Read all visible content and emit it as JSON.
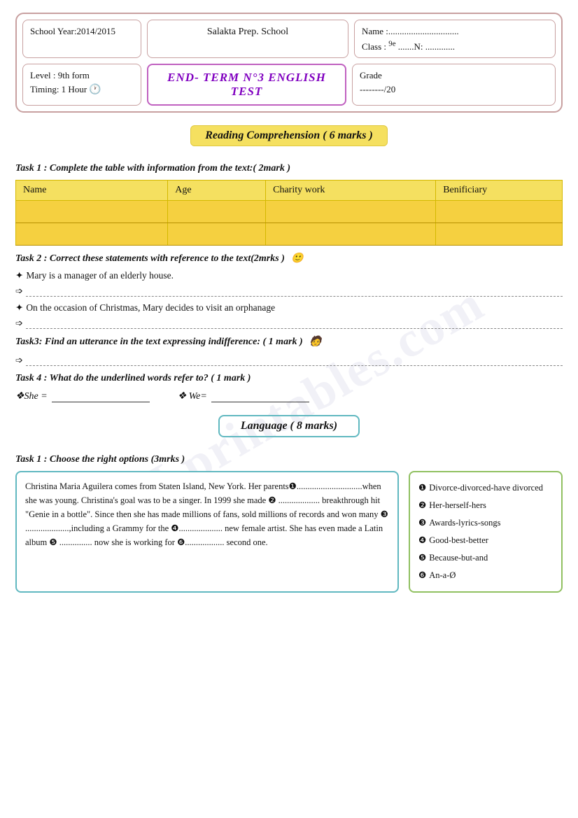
{
  "header": {
    "school_year_label": "School Year:2014/2015",
    "school_name": "Salakta Prep. School",
    "name_label": "Name :",
    "name_dots": "...............................",
    "class_label": "Class :",
    "class_value": "9ᵉ .......N: .............",
    "level_label": "Level : 9th form",
    "timing_label": "Timing: 1 Hour",
    "title": "END- TERM N°3 ENGLISH TEST",
    "grade_label": "Grade",
    "grade_value": "--------/20"
  },
  "reading": {
    "section_title": "Reading Comprehension ( 6 marks )",
    "task1_heading": "Task 1 : Complete the table with information from the text:( 2mark )",
    "table_headers": [
      "Name",
      "Age",
      "Charity work",
      "Benificiary"
    ],
    "task2_heading": "Task 2 :   Correct these statements  with reference to the text(2mrks )",
    "task2_s1": "✦Mary is a manager of an elderly house.",
    "task2_s2": "✦ On the occasion of Christmas, Mary decides to visit an orphanage",
    "task3_heading": "Task3:    Find an utterance in the text expressing indifference: ( 1 mark )",
    "task4_heading": "Task 4 : What do the underlined words refer to? ( 1 mark )",
    "task4_she": "❖She =",
    "task4_we": "❖ We="
  },
  "language": {
    "section_title": "Language  ( 8 marks)",
    "task1_heading": "Task 1 : Choose the right options (3mrks )",
    "passage": "Christina Maria Aguilera comes from Staten Island, New York. Her parents❶..............................when she was young. Christina's goal was to be a singer. In 1999 she made ❷ ................... breakthrough hit \"Genie in a bottle\". Since then she has made millions of fans, sold millions of records and won many ❸ ....................,including a Grammy for the ❹.................... new female artist. She has even made a Latin album ❺ ............... now she is working for ❻.................. second one.",
    "options": [
      {
        "num": "❶",
        "text": "Divorce-divorced-have divorced"
      },
      {
        "num": "❷",
        "text": "Her-herself-hers"
      },
      {
        "num": "❸",
        "text": "Awards-lyrics-songs"
      },
      {
        "num": "❹",
        "text": "Good-best-better"
      },
      {
        "num": "❺",
        "text": "Because-but-and"
      },
      {
        "num": "❻",
        "text": "An-a-Ø"
      }
    ]
  },
  "watermark": {
    "line1": "ESLprintables.com"
  }
}
